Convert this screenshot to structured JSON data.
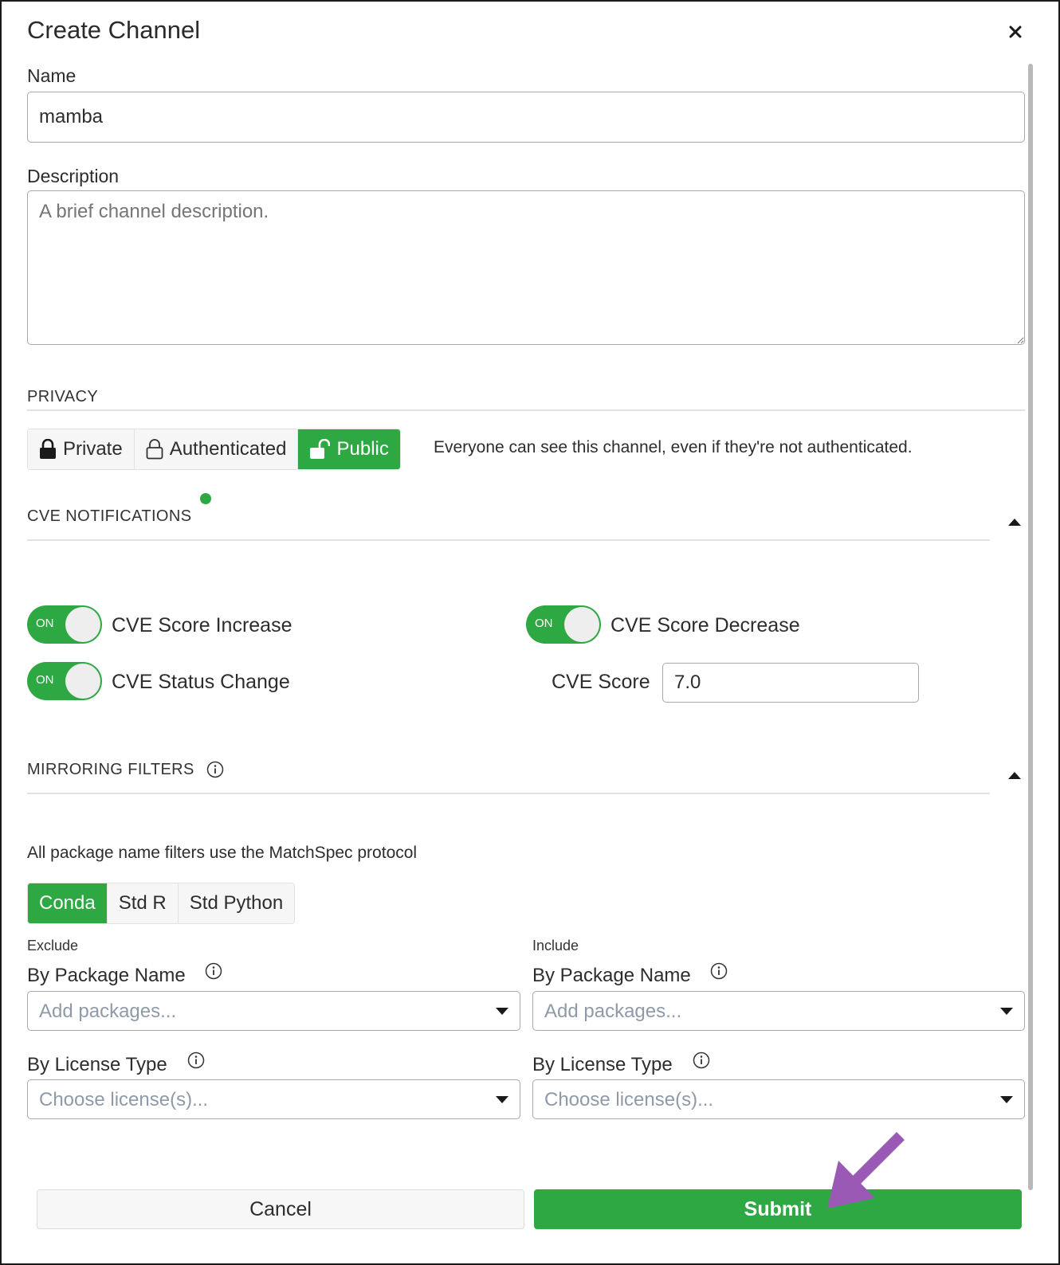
{
  "dialog": {
    "title": "Create Channel",
    "close_icon": "close-icon"
  },
  "name": {
    "label": "Name",
    "value": "mamba"
  },
  "description": {
    "label": "Description",
    "placeholder": "A brief channel description."
  },
  "privacy": {
    "section_label": "PRIVACY",
    "options": [
      {
        "label": "Private",
        "icon": "lock-icon"
      },
      {
        "label": "Authenticated",
        "icon": "lock-outline-icon"
      },
      {
        "label": "Public",
        "icon": "unlock-icon"
      }
    ],
    "selected": "Public",
    "description": "Everyone can see this channel, even if they're not authenticated."
  },
  "cve": {
    "section_label": "CVE NOTIFICATIONS",
    "toggles": [
      {
        "label": "CVE Score Increase",
        "state": "ON"
      },
      {
        "label": "CVE Score Decrease",
        "state": "ON"
      },
      {
        "label": "CVE Status Change",
        "state": "ON"
      }
    ],
    "score_label": "CVE Score",
    "score_value": "7.0"
  },
  "mirroring": {
    "section_label": "MIRRORING FILTERS",
    "matchspec_note": "All package name filters use the MatchSpec protocol",
    "tabs": [
      "Conda",
      "Std R",
      "Std Python"
    ],
    "selected_tab": "Conda",
    "exclude": {
      "label": "Exclude",
      "package_label": "By Package Name",
      "package_placeholder": "Add packages...",
      "license_label": "By License Type",
      "license_placeholder": "Choose license(s)..."
    },
    "include": {
      "label": "Include",
      "package_label": "By Package Name",
      "package_placeholder": "Add packages...",
      "license_label": "By License Type",
      "license_placeholder": "Choose license(s)..."
    }
  },
  "footer": {
    "cancel_label": "Cancel",
    "submit_label": "Submit"
  },
  "colors": {
    "accent": "#2ea843",
    "arrow": "#9b59b6",
    "placeholder": "#8f9aa8"
  }
}
